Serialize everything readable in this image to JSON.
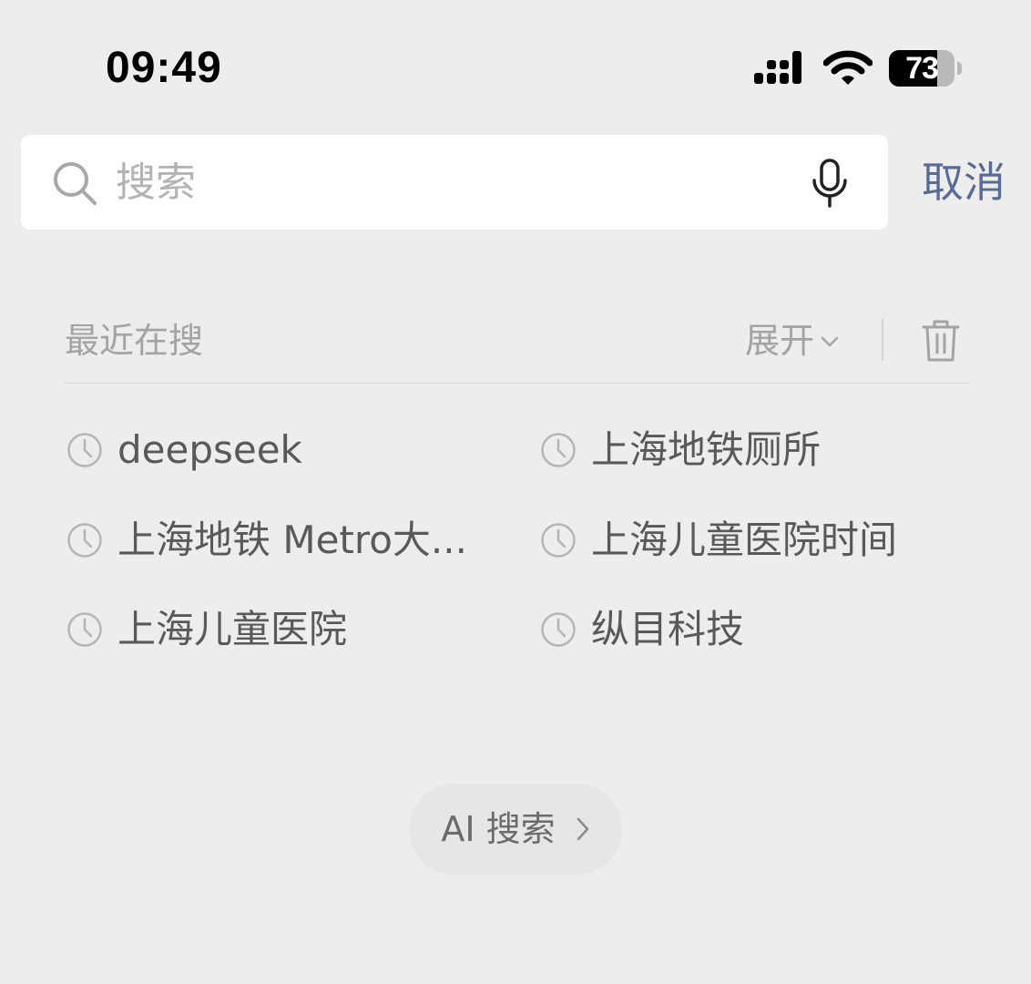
{
  "status_bar": {
    "time": "09:49",
    "battery_level": "73",
    "battery_fraction": 0.73,
    "icons": [
      "signal-icon",
      "wifi-icon",
      "battery-icon"
    ]
  },
  "search": {
    "placeholder": "搜索",
    "value": "",
    "icons": [
      "search-icon",
      "mic-icon"
    ]
  },
  "cancel_label": "取消",
  "recent": {
    "title": "最近在搜",
    "expand_label": "展开",
    "icons": [
      "chevron-down-icon",
      "trash-icon",
      "clock-icon"
    ],
    "items": [
      {
        "label": "deepseek"
      },
      {
        "label": "上海地铁厕所"
      },
      {
        "label": "上海地铁 Metro大..."
      },
      {
        "label": "上海儿童医院时间"
      },
      {
        "label": "上海儿童医院"
      },
      {
        "label": "纵目科技"
      }
    ]
  },
  "ai_search": {
    "label": "AI 搜索",
    "icon": "chevron-right-icon"
  },
  "colors": {
    "background": "#ededed",
    "accent_link": "#576b95",
    "muted_text": "#a3a3a3",
    "item_text": "#595959"
  }
}
